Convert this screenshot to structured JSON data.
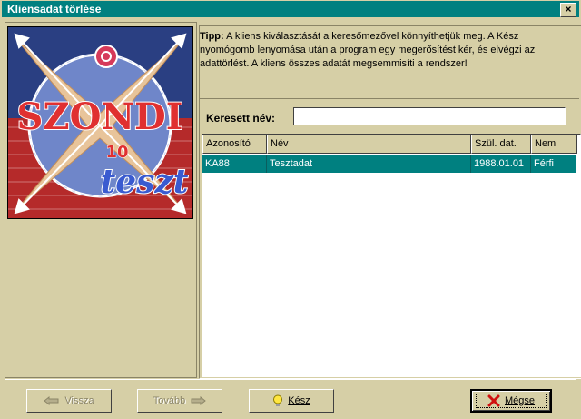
{
  "window": {
    "title": "Kliensadat törlése",
    "close_glyph": "×"
  },
  "logo": {
    "text": "SZONDI",
    "number": "10",
    "script": "teszt"
  },
  "tip": {
    "label": "Tipp:",
    "text": "A kliens kiválasztását a keresőmezővel könnyíthetjük meg. A Kész nyomógomb lenyomása után a program egy megerősítést kér, és elvégzi az adattörlést. A kliens összes adatát megsemmisíti a rendszer!"
  },
  "search": {
    "label": "Keresett név:",
    "value": ""
  },
  "table": {
    "columns": [
      "Azonosító",
      "Név",
      "Szül. dat.",
      "Nem"
    ],
    "rows": [
      {
        "id": "KA88",
        "name": "Tesztadat",
        "birth": "1988.01.01",
        "sex": "Férfi"
      }
    ]
  },
  "buttons": {
    "back": "Vissza",
    "next": "Tovább",
    "done": "Kész",
    "cancel": "Mégse"
  },
  "colors": {
    "titlebar": "#008080",
    "selection": "#008080",
    "face": "#d6cfa6"
  }
}
